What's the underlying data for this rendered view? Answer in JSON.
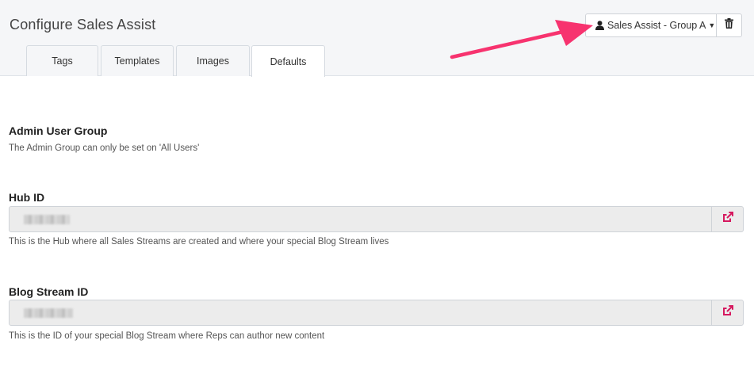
{
  "page": {
    "title": "Configure Sales Assist"
  },
  "header": {
    "group_selector": {
      "label": "Sales Assist - Group A",
      "icon": "user-icon"
    },
    "delete_icon": "trash-icon"
  },
  "tabs": [
    {
      "label": "Tags",
      "active": false
    },
    {
      "label": "Templates",
      "active": false
    },
    {
      "label": "Images",
      "active": false
    },
    {
      "label": "Defaults",
      "active": true
    }
  ],
  "sections": {
    "admin_group": {
      "heading": "Admin User Group",
      "help": "The Admin Group can only be set on 'All Users'"
    },
    "hub_id": {
      "heading": "Hub ID",
      "value": "",
      "help": "This is the Hub where all Sales Streams are created and where your special Blog Stream lives",
      "action_icon": "external-link-icon"
    },
    "blog_stream_id": {
      "heading": "Blog Stream ID",
      "value": "",
      "help": "This is the ID of your special Blog Stream where Reps can author new content",
      "action_icon": "external-link-icon"
    }
  },
  "colors": {
    "accent": "#d6195f",
    "annotation_arrow": "#f7336f",
    "header_bg": "#f5f6f8",
    "field_bg": "#ececec"
  }
}
